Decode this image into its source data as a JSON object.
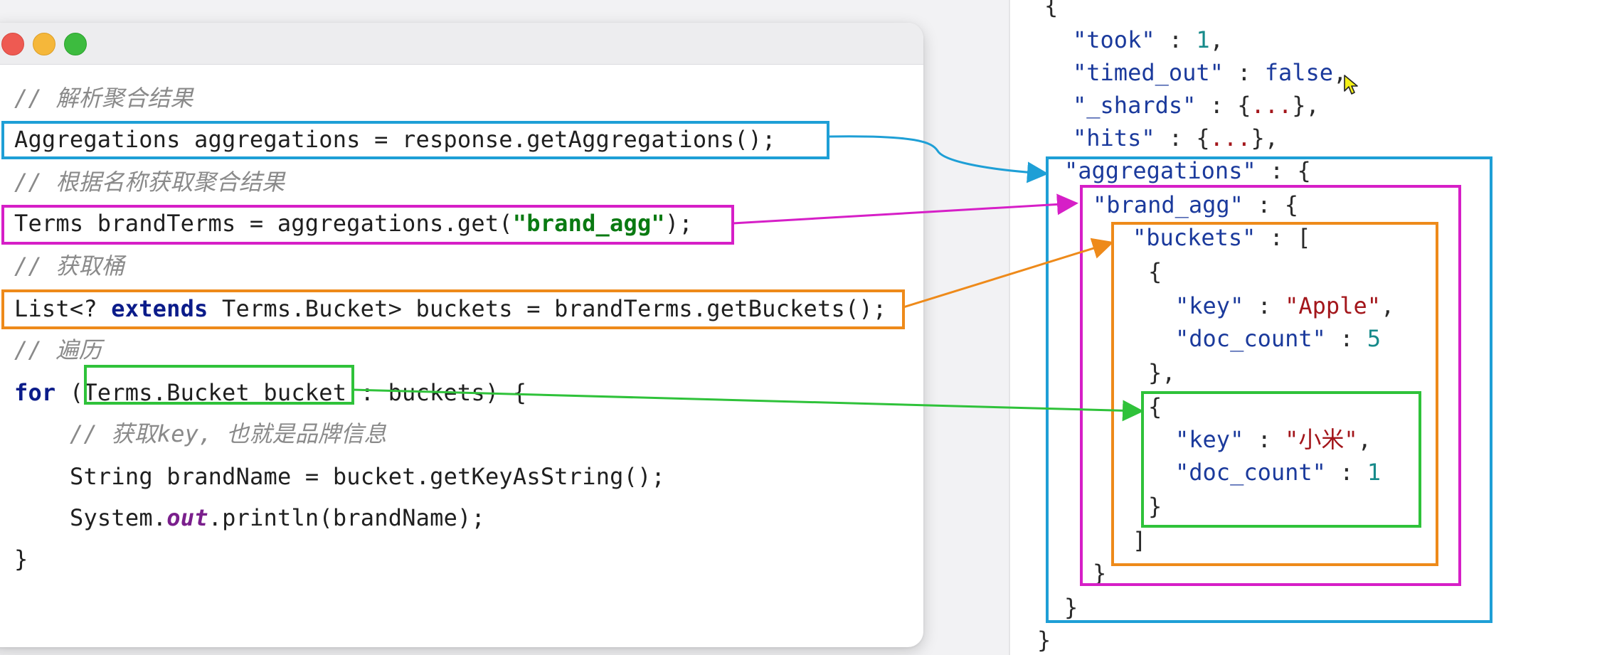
{
  "window": {
    "controls": [
      "close",
      "minimize",
      "maximize"
    ]
  },
  "code": {
    "comment_parse": "// 解析聚合结果",
    "line_aggregations": "Aggregations aggregations = response.getAggregations();",
    "comment_get_by_name": "// 根据名称获取聚合结果",
    "line_terms_prefix": "Terms brandTerms = aggregations.get(",
    "line_terms_string": "\"brand_agg\"",
    "line_terms_suffix": ");",
    "comment_get_buckets": "// 获取桶",
    "line_list_prefix": "List<? ",
    "line_list_keyword": "extends",
    "line_list_suffix": " Terms.Bucket> buckets = brandTerms.getBuckets();",
    "comment_iterate": "// 遍历",
    "line_for_keyword": "for",
    "line_for_rest": " (Terms.Bucket bucket : buckets) {",
    "comment_get_key": "// 获取key, 也就是品牌信息",
    "line_brandname": "String brandName = bucket.getKeyAsString();",
    "line_println_prefix": "System.",
    "line_println_field": "out",
    "line_println_suffix": ".println(brandName);",
    "line_close": "}"
  },
  "json": {
    "open_brace": "{",
    "took_key": "\"took\"",
    "took_value": "1",
    "timed_out_key": "\"timed_out\"",
    "timed_out_value": "false",
    "shards_key": "\"_shards\"",
    "shards_value": "...",
    "hits_key": "\"hits\"",
    "hits_value": "...",
    "aggregations_key": "\"aggregations\"",
    "brand_agg_key": "\"brand_agg\"",
    "buckets_key": "\"buckets\"",
    "key_label": "\"key\"",
    "doc_count_label": "\"doc_count\"",
    "bucket1_key": "\"Apple\"",
    "bucket1_count": "5",
    "bucket2_key": "\"小米\"",
    "bucket2_count": "1"
  },
  "colors": {
    "aggregations_box": "#1e9fd6",
    "brand_agg_box": "#d61fc7",
    "buckets_box": "#ee8a1a",
    "bucket_box": "#2fc23a"
  }
}
